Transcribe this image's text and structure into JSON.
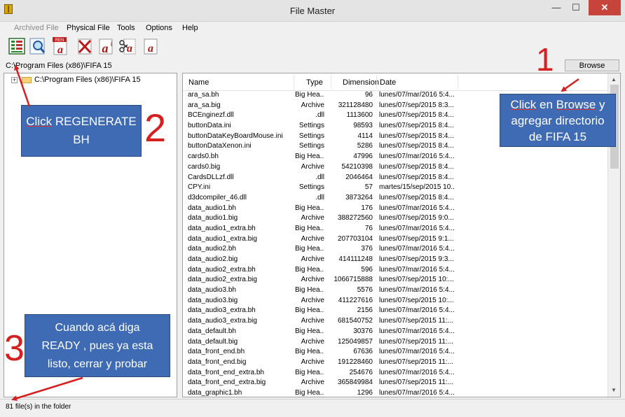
{
  "window": {
    "title": "File Master",
    "minimize": "—",
    "maximize": "☐",
    "close": "✕"
  },
  "menu": [
    {
      "label": "Archived File",
      "disabled": true
    },
    {
      "label": "Physical File",
      "disabled": false
    },
    {
      "label": "Tools",
      "disabled": false
    },
    {
      "label": "Options",
      "disabled": false
    },
    {
      "label": "Help",
      "disabled": false
    }
  ],
  "toolbar": {
    "buttons": [
      {
        "name": "regenerate-bh-icon"
      },
      {
        "name": "search-icon"
      },
      {
        "name": "rename-icon",
        "badge": "REN"
      },
      {
        "name": "delete-icon"
      },
      {
        "name": "add-file-icon"
      },
      {
        "name": "cut-icon"
      },
      {
        "name": "new-file-icon"
      }
    ]
  },
  "path": {
    "value": "C:\\Program Files (x86)\\FIFA 15",
    "browse_label": "Browse"
  },
  "tree": {
    "root_label": "C:\\Program Files (x86)\\FIFA 15",
    "expand_glyph": "+"
  },
  "file_list": {
    "columns": [
      "Name",
      "Type",
      "Dimension",
      "Date"
    ],
    "rows": [
      {
        "name": "ara_sa.bh",
        "type": "Big Hea...",
        "size": "96",
        "date": "lunes/07/mar/2016 5:4..."
      },
      {
        "name": "ara_sa.big",
        "type": "Archive",
        "size": "321128480",
        "date": "lunes/07/sep/2015 8:3..."
      },
      {
        "name": "BCEnginezf.dll",
        "type": ".dll",
        "size": "1113600",
        "date": "lunes/07/sep/2015 8:4..."
      },
      {
        "name": "buttonData.ini",
        "type": "Settings",
        "size": "98593",
        "date": "lunes/07/sep/2015 8:4..."
      },
      {
        "name": "buttonDataKeyBoardMouse.ini",
        "type": "Settings",
        "size": "4114",
        "date": "lunes/07/sep/2015 8:4..."
      },
      {
        "name": "buttonDataXenon.ini",
        "type": "Settings",
        "size": "5286",
        "date": "lunes/07/sep/2015 8:4..."
      },
      {
        "name": "cards0.bh",
        "type": "Big Hea...",
        "size": "47996",
        "date": "lunes/07/mar/2016 5:4..."
      },
      {
        "name": "cards0.big",
        "type": "Archive",
        "size": "54210398",
        "date": "lunes/07/sep/2015 8:4..."
      },
      {
        "name": "CardsDLLzf.dll",
        "type": ".dll",
        "size": "2046464",
        "date": "lunes/07/sep/2015 8:4..."
      },
      {
        "name": "CPY.ini",
        "type": "Settings",
        "size": "57",
        "date": "martes/15/sep/2015 10..."
      },
      {
        "name": "d3dcompiler_46.dll",
        "type": ".dll",
        "size": "3873264",
        "date": "lunes/07/sep/2015 8:4..."
      },
      {
        "name": "data_audio1.bh",
        "type": "Big Hea...",
        "size": "176",
        "date": "lunes/07/mar/2016 5:4..."
      },
      {
        "name": "data_audio1.big",
        "type": "Archive",
        "size": "388272560",
        "date": "lunes/07/sep/2015 9:0..."
      },
      {
        "name": "data_audio1_extra.bh",
        "type": "Big Hea...",
        "size": "76",
        "date": "lunes/07/mar/2016 5:4..."
      },
      {
        "name": "data_audio1_extra.big",
        "type": "Archive",
        "size": "207703104",
        "date": "lunes/07/sep/2015 9:1..."
      },
      {
        "name": "data_audio2.bh",
        "type": "Big Hea...",
        "size": "376",
        "date": "lunes/07/mar/2016 5:4..."
      },
      {
        "name": "data_audio2.big",
        "type": "Archive",
        "size": "414111248",
        "date": "lunes/07/sep/2015 9:3..."
      },
      {
        "name": "data_audio2_extra.bh",
        "type": "Big Hea...",
        "size": "596",
        "date": "lunes/07/mar/2016 5:4..."
      },
      {
        "name": "data_audio2_extra.big",
        "type": "Archive",
        "size": "1066715888",
        "date": "lunes/07/sep/2015 10:..."
      },
      {
        "name": "data_audio3.bh",
        "type": "Big Hea...",
        "size": "5576",
        "date": "lunes/07/mar/2016 5:4..."
      },
      {
        "name": "data_audio3.big",
        "type": "Archive",
        "size": "411227616",
        "date": "lunes/07/sep/2015 10:..."
      },
      {
        "name": "data_audio3_extra.bh",
        "type": "Big Hea...",
        "size": "2156",
        "date": "lunes/07/mar/2016 5:4..."
      },
      {
        "name": "data_audio3_extra.big",
        "type": "Archive",
        "size": "681540752",
        "date": "lunes/07/sep/2015 11:..."
      },
      {
        "name": "data_default.bh",
        "type": "Big Hea...",
        "size": "30376",
        "date": "lunes/07/mar/2016 5:4..."
      },
      {
        "name": "data_default.big",
        "type": "Archive",
        "size": "125049857",
        "date": "lunes/07/sep/2015 11:..."
      },
      {
        "name": "data_front_end.bh",
        "type": "Big Hea...",
        "size": "67636",
        "date": "lunes/07/mar/2016 5:4..."
      },
      {
        "name": "data_front_end.big",
        "type": "Archive",
        "size": "191228460",
        "date": "lunes/07/sep/2015 11:..."
      },
      {
        "name": "data_front_end_extra.bh",
        "type": "Big Hea...",
        "size": "254676",
        "date": "lunes/07/mar/2016 5:4..."
      },
      {
        "name": "data_front_end_extra.big",
        "type": "Archive",
        "size": "365849984",
        "date": "lunes/07/sep/2015 11:..."
      },
      {
        "name": "data_graphic1.bh",
        "type": "Big Hea...",
        "size": "1296",
        "date": "lunes/07/mar/2016 5:4..."
      }
    ]
  },
  "status": {
    "text": "81 file(s) in the folder"
  },
  "annotations": {
    "num1": "1",
    "num2": "2",
    "num3": "3",
    "callout_browse": {
      "click": "Click",
      "en": " en ",
      "browse": "Browse",
      "y": " y",
      "line2": "agregar directorio",
      "line3": "de FIFA 15"
    },
    "callout_regen": {
      "click": "Click",
      "rest": " REGENERATE",
      "line2": "BH"
    },
    "callout_ready": {
      "line1": "Cuando acá diga",
      "line2": "READY , pues ya esta",
      "line3": "listo, cerrar y probar"
    },
    "colors": {
      "callout_bg": "#3f6bb5",
      "arrow": "#d62020"
    }
  }
}
